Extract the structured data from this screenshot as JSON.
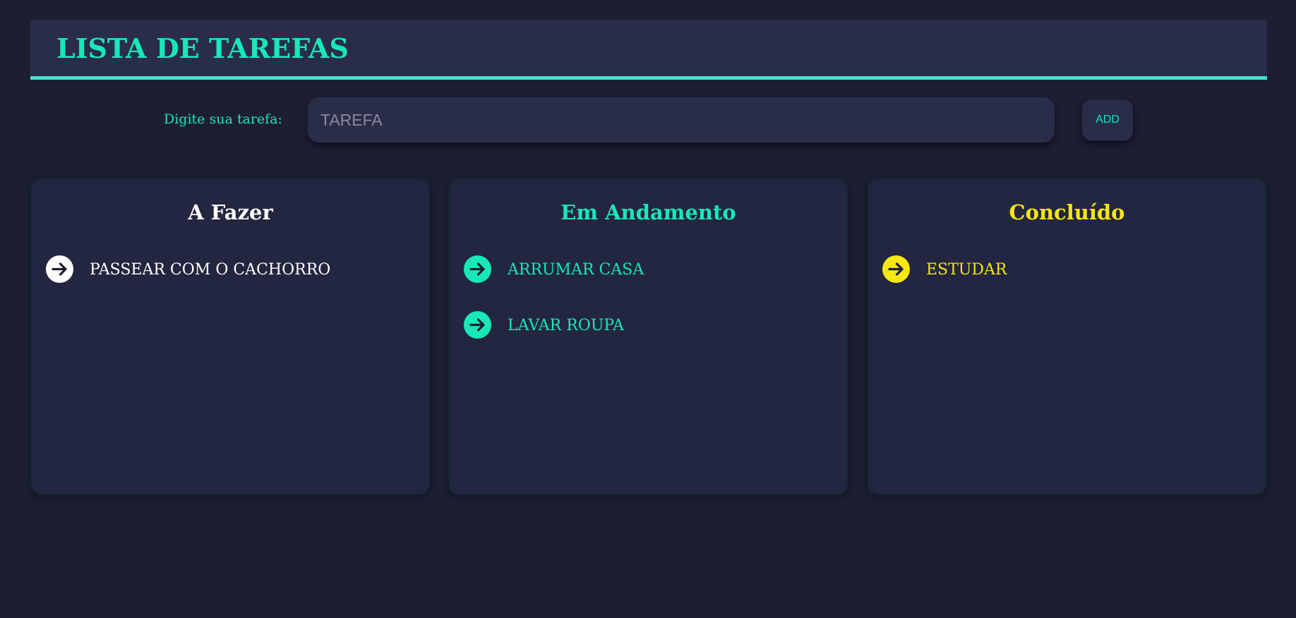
{
  "header": {
    "title": "LISTA DE TAREFAS"
  },
  "form": {
    "label": "Digite sua tarefa:",
    "input_placeholder": "TAREFA",
    "input_value": "",
    "add_label": "ADD"
  },
  "columns": [
    {
      "title": "A Fazer",
      "color": "#ffffff",
      "tasks": [
        {
          "text": "PASSEAR COM O CACHORRO",
          "icon": "arrow-right-circle-icon"
        }
      ]
    },
    {
      "title": "Em Andamento",
      "color": "#18e8b8",
      "tasks": [
        {
          "text": "ARRUMAR CASA",
          "icon": "arrow-right-circle-icon"
        },
        {
          "text": "LAVAR ROUPA",
          "icon": "arrow-right-circle-icon"
        }
      ]
    },
    {
      "title": "Concluído",
      "color": "#f6e611",
      "tasks": [
        {
          "text": "ESTUDAR",
          "icon": "arrow-right-circle-icon"
        }
      ]
    }
  ],
  "colors": {
    "background": "#1c1f32",
    "panel": "#2a2d4a",
    "accent": "#18e8b8",
    "done": "#f6e611"
  }
}
